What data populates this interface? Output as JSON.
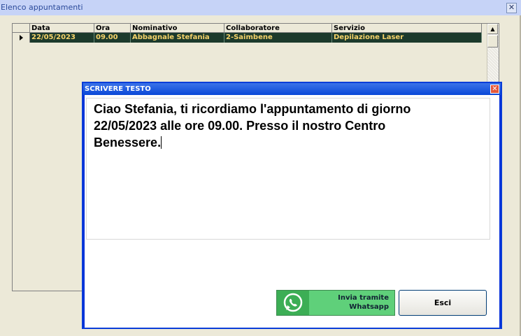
{
  "window": {
    "title": "Elenco appuntamenti",
    "close_glyph": "✕"
  },
  "grid": {
    "columns": [
      "Data",
      "Ora",
      "Nominativo",
      "Collaboratore",
      "Servizio"
    ],
    "rows": [
      {
        "data": "22/05/2023",
        "ora": "09.00",
        "nominativo": "Abbagnale Stefania",
        "collaboratore": "2-Saimbene",
        "servizio": "Depilazione Laser"
      }
    ]
  },
  "dialog": {
    "title": "SCRIVERE TESTO",
    "close_glyph": "✕",
    "message": "Ciao Stefania, ti ricordiamo l'appuntamento di giorno\n22/05/2023 alle ore 09.00. Presso il nostro Centro\nBenessere.",
    "whatsapp_button": "Invia tramite\nWhatsapp",
    "whatsapp_icon": "whatsapp-icon",
    "exit_button": "Esci"
  },
  "colors": {
    "selected_row_bg": "#1c3a2c",
    "selected_row_text": "#f5d36a",
    "whatsapp_green": "#5fd07a",
    "dialog_border": "#0a3dd8"
  }
}
